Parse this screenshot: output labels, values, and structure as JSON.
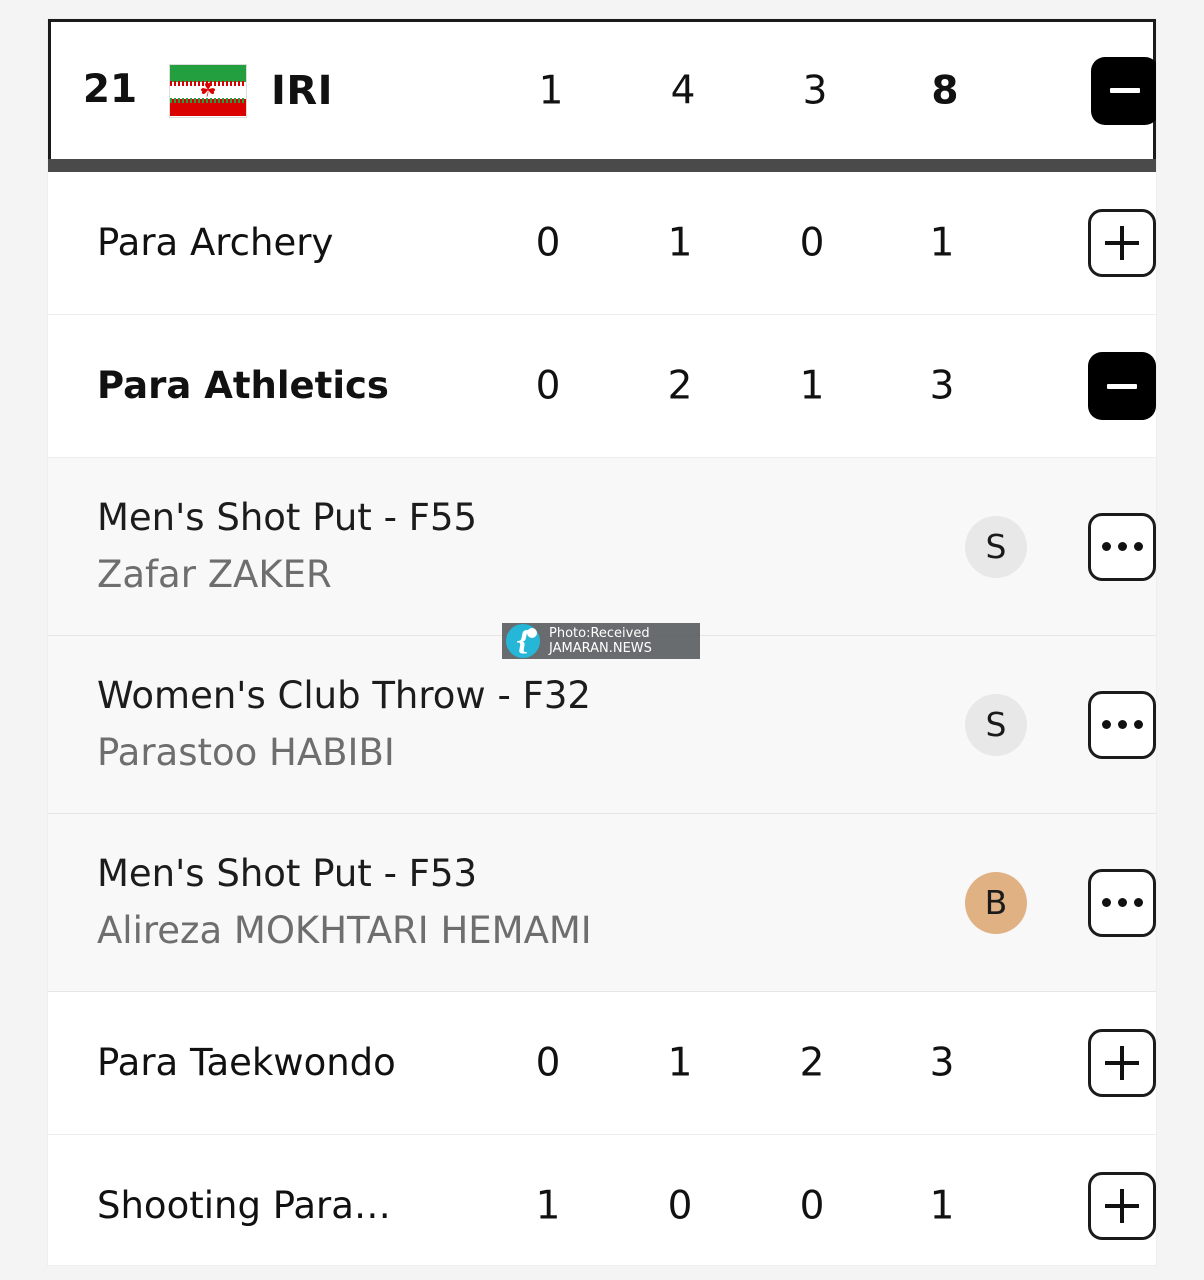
{
  "header": {
    "rank": "21",
    "flag_name": "iran-flag-icon",
    "noc": "IRI",
    "gold": "1",
    "silver": "4",
    "bronze": "3",
    "total": "8",
    "toggle": "collapse-icon"
  },
  "watermark": {
    "line1": "Photo:Received",
    "line2": "JAMARAN.NEWS",
    "logo": "jamaran-logo-icon"
  },
  "colors": {
    "silver_badge": "#e8e8e8",
    "bronze_badge": "#e0b183",
    "separator": "#4a4a4a",
    "event_row_bg": "#f8f8f8",
    "flag_green": "#239f40",
    "flag_red": "#da0000",
    "watermark_logo": "#25b6d8"
  },
  "rows": [
    {
      "kind": "sport",
      "label": "Para Archery",
      "gold": "0",
      "silver": "1",
      "bronze": "0",
      "total": "1",
      "expanded": false,
      "toggle_label": "+"
    },
    {
      "kind": "sport",
      "label": "Para Athletics",
      "gold": "0",
      "silver": "2",
      "bronze": "1",
      "total": "3",
      "expanded": true,
      "toggle_label": "−"
    },
    {
      "kind": "event",
      "title": "Men's Shot Put - F55",
      "athlete": "Zafar ZAKER",
      "medal": "S",
      "medal_type": "silver",
      "more_label": "more-options"
    },
    {
      "kind": "event",
      "title": "Women's Club Throw - F32",
      "athlete": "Parastoo HABIBI",
      "medal": "S",
      "medal_type": "silver",
      "more_label": "more-options"
    },
    {
      "kind": "event",
      "title": "Men's Shot Put - F53",
      "athlete": "Alireza MOKHTARI HEMAMI",
      "medal": "B",
      "medal_type": "bronze",
      "more_label": "more-options"
    },
    {
      "kind": "sport",
      "label": "Para Taekwondo",
      "gold": "0",
      "silver": "1",
      "bronze": "2",
      "total": "3",
      "expanded": false,
      "toggle_label": "+"
    },
    {
      "kind": "sport",
      "label": "Shooting Para…",
      "gold": "1",
      "silver": "0",
      "bronze": "0",
      "total": "1",
      "expanded": false,
      "toggle_label": "+"
    }
  ]
}
